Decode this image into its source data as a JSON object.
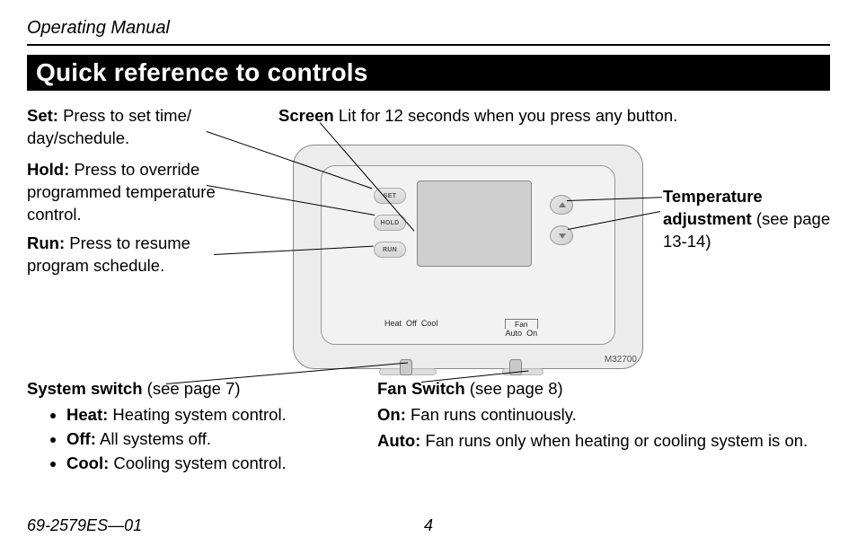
{
  "header": {
    "manual_title": "Operating Manual"
  },
  "title": "Quick reference to controls",
  "callouts": {
    "set": {
      "label": "Set:",
      "text": " Press to set time/ day/schedule."
    },
    "hold": {
      "label": "Hold:",
      "text": " Press to override programmed tempera­ture control."
    },
    "run": {
      "label": "Run:",
      "text": " Press to resume program schedule."
    },
    "screen": {
      "label": "Screen",
      "text": " Lit for 12 seconds when you press any button."
    },
    "temp": {
      "label": "Temperature adjustment",
      "text": " (see page 13-14)"
    },
    "system": {
      "label": "System switch",
      "text": " (see page 7)",
      "items": [
        {
          "label": "Heat:",
          "text": " Heating system control."
        },
        {
          "label": "Off:",
          "text": " All systems off."
        },
        {
          "label": "Cool:",
          "text": " Cooling system control."
        }
      ]
    },
    "fan": {
      "label": "Fan Switch",
      "text": " (see page 8)",
      "on": {
        "label": "On:",
        "text": " Fan runs continuously."
      },
      "auto": {
        "label": "Auto:",
        "text": " Fan runs only when heating or cooling system is on."
      }
    }
  },
  "device": {
    "buttons": {
      "set": "SET",
      "hold": "HOLD",
      "run": "RUN"
    },
    "system_switch": {
      "heat": "Heat",
      "off": "Off",
      "cool": "Cool"
    },
    "fan_switch": {
      "title": "Fan",
      "auto": "Auto",
      "on": "On"
    },
    "model": "M32700"
  },
  "footer": {
    "doc_no": "69-2579ES—01",
    "page": "4"
  }
}
